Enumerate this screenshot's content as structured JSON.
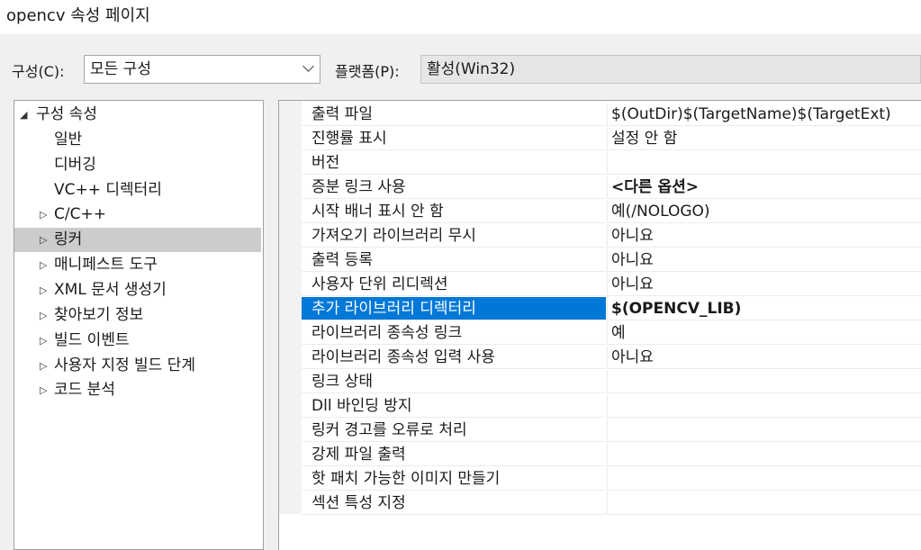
{
  "window": {
    "title": "opencv 속성 페이지"
  },
  "config": {
    "config_label": "구성(C):",
    "config_value": "모든 구성",
    "platform_label": "플랫폼(P):",
    "platform_value": "활성(Win32)"
  },
  "tree": {
    "items": [
      {
        "label": "구성 속성",
        "arrow": "◢",
        "level": 0
      },
      {
        "label": "일반",
        "arrow": "",
        "level": 1
      },
      {
        "label": "디버깅",
        "arrow": "",
        "level": 1
      },
      {
        "label": "VC++ 디렉터리",
        "arrow": "",
        "level": 1
      },
      {
        "label": "C/C++",
        "arrow": "▷",
        "level": 1
      },
      {
        "label": "링커",
        "arrow": "▷",
        "level": 1,
        "selected": true
      },
      {
        "label": "매니페스트 도구",
        "arrow": "▷",
        "level": 1
      },
      {
        "label": "XML 문서 생성기",
        "arrow": "▷",
        "level": 1
      },
      {
        "label": "찾아보기 정보",
        "arrow": "▷",
        "level": 1
      },
      {
        "label": "빌드 이벤트",
        "arrow": "▷",
        "level": 1
      },
      {
        "label": "사용자 지정 빌드 단계",
        "arrow": "▷",
        "level": 1
      },
      {
        "label": "코드 분석",
        "arrow": "▷",
        "level": 1
      }
    ]
  },
  "properties": {
    "rows": [
      {
        "name": "출력 파일",
        "value": "$(OutDir)$(TargetName)$(TargetExt)"
      },
      {
        "name": "진행률 표시",
        "value": "설정 안 함"
      },
      {
        "name": "버전",
        "value": ""
      },
      {
        "name": "증분 링크 사용",
        "value": "<다른 옵션>",
        "bold": true
      },
      {
        "name": "시작 배너 표시 안 함",
        "value": "예(/NOLOGO)"
      },
      {
        "name": "가져오기 라이브러리 무시",
        "value": "아니요"
      },
      {
        "name": "출력 등록",
        "value": "아니요"
      },
      {
        "name": "사용자 단위 리디렉션",
        "value": "아니요"
      },
      {
        "name": "추가 라이브러리 디렉터리",
        "value": "$(OPENCV_LIB)",
        "bold": true,
        "selected": true
      },
      {
        "name": "라이브러리 종속성 링크",
        "value": "예"
      },
      {
        "name": "라이브러리 종속성 입력 사용",
        "value": "아니요"
      },
      {
        "name": "링크 상태",
        "value": ""
      },
      {
        "name": "Dll 바인딩 방지",
        "value": ""
      },
      {
        "name": "링커 경고를 오류로 처리",
        "value": ""
      },
      {
        "name": "강제 파일 출력",
        "value": ""
      },
      {
        "name": "핫 패치 가능한 이미지 만들기",
        "value": ""
      },
      {
        "name": "섹션 특성 지정",
        "value": ""
      }
    ]
  },
  "colors": {
    "selection": "#0078d7",
    "tree_selection": "#cccccc"
  }
}
